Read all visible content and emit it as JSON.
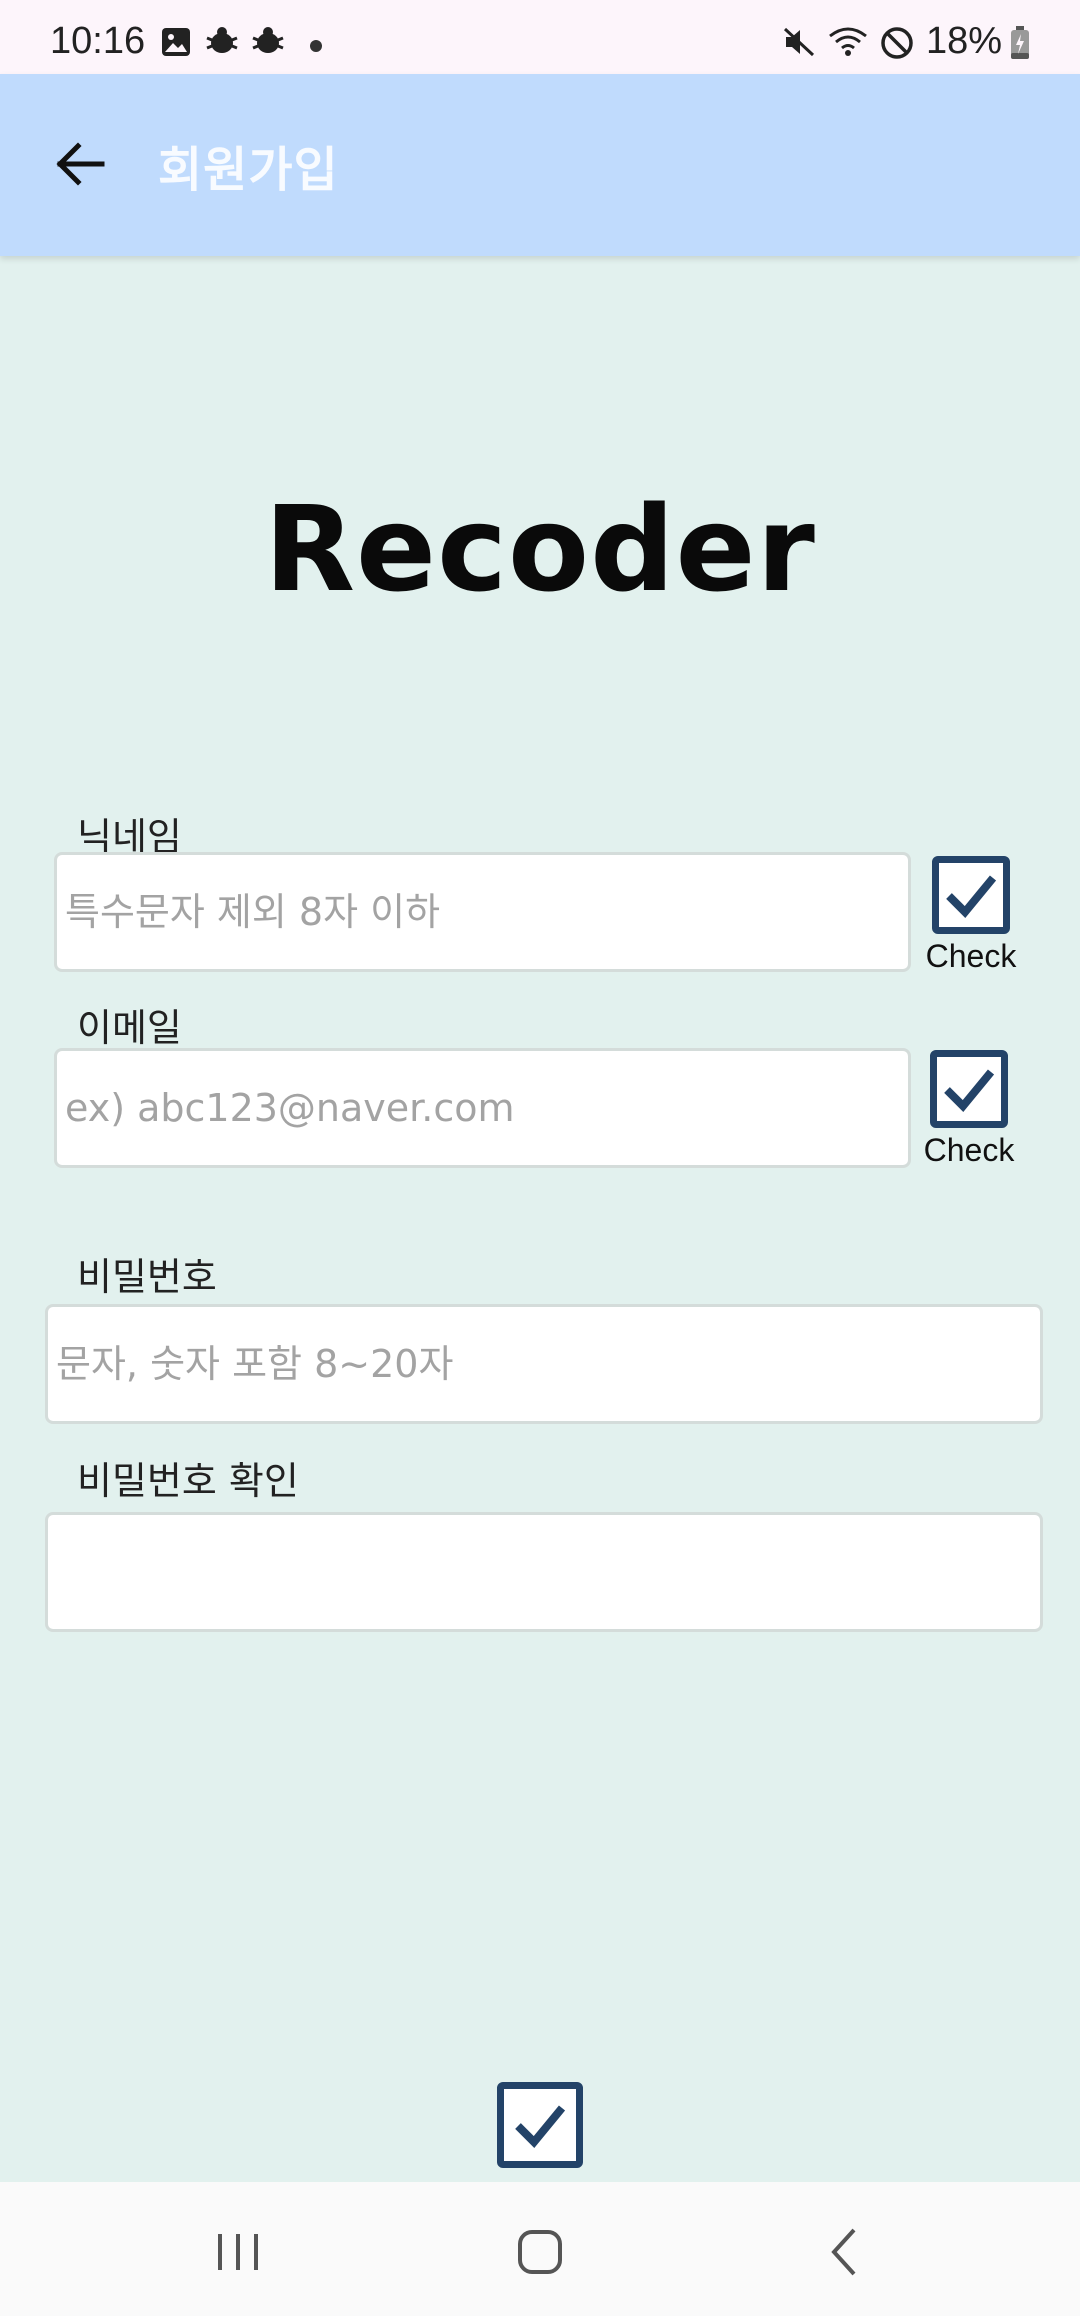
{
  "status_bar": {
    "time": "10:16",
    "battery": "18%",
    "icons": [
      "gallery-icon",
      "bug-icon",
      "bug-icon",
      "dot-icon",
      "mute-icon",
      "wifi-icon",
      "do-not-disturb-icon",
      "battery-icon"
    ]
  },
  "app_bar": {
    "title": "회원가입",
    "back_icon": "arrow-left-icon"
  },
  "brand": {
    "name": "Recoder"
  },
  "form": {
    "nickname": {
      "label": "닉네임",
      "placeholder": "특수문자 제외 8자 이하",
      "value": "",
      "check_label": "Check"
    },
    "email": {
      "label": "이메일",
      "placeholder": "ex) abc123@naver.com",
      "value": "",
      "check_label": "Check"
    },
    "password": {
      "label": "비밀번호",
      "placeholder": "문자, 숫자 포함 8~20자",
      "value": ""
    },
    "password_confirm": {
      "label": "비밀번호 확인",
      "placeholder": "",
      "value": ""
    }
  },
  "submit": {
    "icon": "check-box-icon"
  },
  "nav_bar": {
    "recents_icon": "recents-icon",
    "home_icon": "home-icon",
    "back_icon": "chevron-left-icon"
  },
  "colors": {
    "background": "#e2f1ee",
    "app_bar": "#c0dbfd",
    "check_border": "#234368"
  }
}
